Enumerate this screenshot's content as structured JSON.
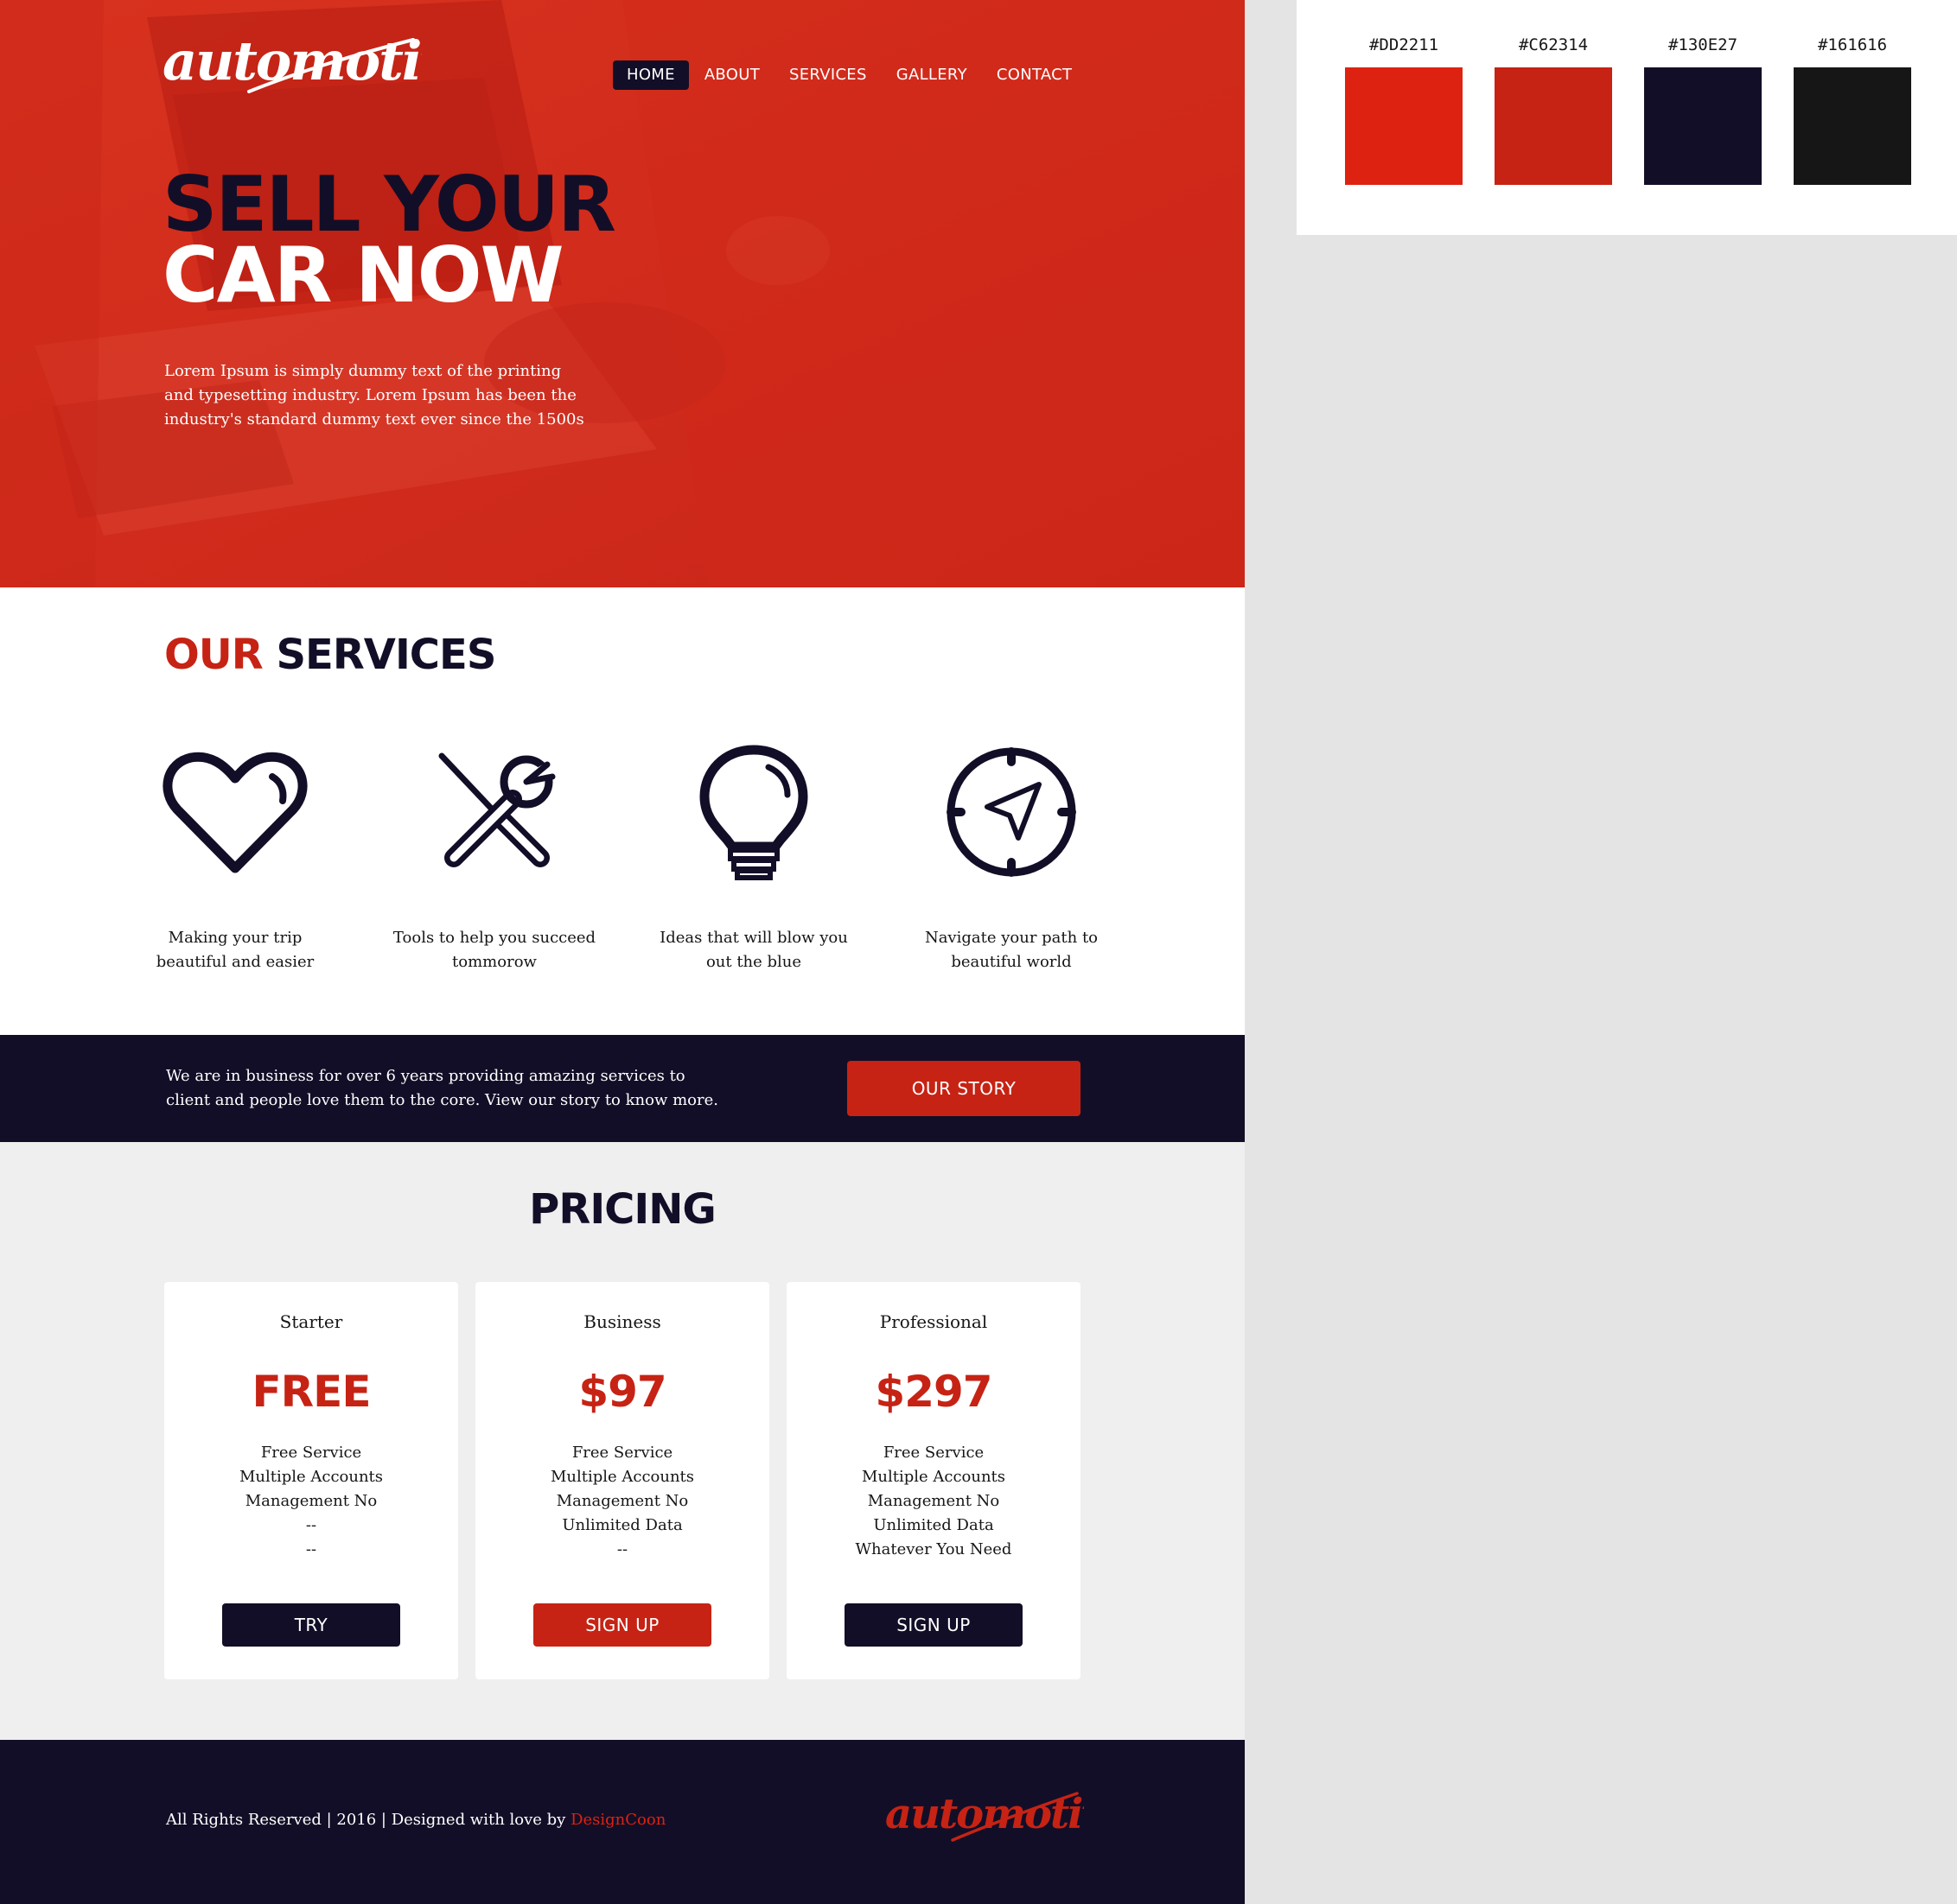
{
  "brand": {
    "name": "automotive"
  },
  "nav": {
    "items": [
      {
        "label": "HOME",
        "active": true
      },
      {
        "label": "ABOUT",
        "active": false
      },
      {
        "label": "SERVICES",
        "active": false
      },
      {
        "label": "GALLERY",
        "active": false
      },
      {
        "label": "CONTACT",
        "active": false
      }
    ]
  },
  "hero": {
    "title_line1": "SELL YOUR",
    "title_line2": "CAR NOW",
    "text": "Lorem Ipsum is simply dummy text of the printing and typesetting industry. Lorem Ipsum has been the industry's standard dummy text ever since the 1500s"
  },
  "services": {
    "heading_accent": "OUR",
    "heading_rest": "SERVICES",
    "items": [
      {
        "icon": "heart-icon",
        "text": "Making your trip beautiful and easier"
      },
      {
        "icon": "tools-icon",
        "text": "Tools to help you succeed tommorow"
      },
      {
        "icon": "lightbulb-icon",
        "text": "Ideas that will blow you out the blue"
      },
      {
        "icon": "compass-icon",
        "text": "Navigate your path to beautiful world"
      }
    ]
  },
  "banner": {
    "text": "We are in business for over 6 years providing amazing services to client and people love them to the core. View our story to know more.",
    "button": "OUR STORY"
  },
  "pricing": {
    "title": "PRICING",
    "plans": [
      {
        "name": "Starter",
        "price": "FREE",
        "features": [
          "Free Service",
          "Multiple Accounts",
          "Management No",
          "--",
          "--"
        ],
        "button": "TRY",
        "button_style": "dark"
      },
      {
        "name": "Business",
        "price": "$97",
        "features": [
          "Free Service",
          "Multiple Accounts",
          "Management No",
          "Unlimited Data",
          "--"
        ],
        "button": "SIGN UP",
        "button_style": "red"
      },
      {
        "name": "Professional",
        "price": "$297",
        "features": [
          "Free Service",
          "Multiple Accounts",
          "Management No",
          "Unlimited Data",
          "Whatever You Need"
        ],
        "button": "SIGN UP",
        "button_style": "dark"
      }
    ]
  },
  "footer": {
    "rights": "All Rights Reserved |  2016  |  Designed with love by ",
    "credit": "DesignCoon"
  },
  "palette": [
    {
      "label": "#DD2211",
      "color": "#DD2211"
    },
    {
      "label": "#C62314",
      "color": "#C62314"
    },
    {
      "label": "#130E27",
      "color": "#130E27"
    },
    {
      "label": "#161616",
      "color": "#161616"
    }
  ]
}
